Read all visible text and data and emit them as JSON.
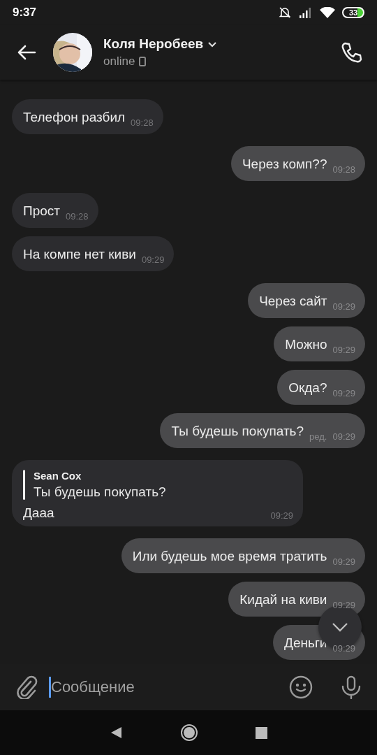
{
  "status_bar": {
    "time": "9:37",
    "battery": "33"
  },
  "header": {
    "name": "Коля Неробеев",
    "status": "online"
  },
  "messages": [
    {
      "kind": "incoming",
      "text": "Телефон разбил",
      "time": "09:28"
    },
    {
      "kind": "outgoing",
      "text": "Через комп??",
      "time": "09:28"
    },
    {
      "kind": "incoming",
      "text": "Прост",
      "time": "09:28"
    },
    {
      "kind": "incoming",
      "text": "На компе нет киви",
      "time": "09:29"
    },
    {
      "kind": "outgoing",
      "text": "Через сайт",
      "time": "09:29"
    },
    {
      "kind": "outgoing",
      "text": "Можно",
      "time": "09:29"
    },
    {
      "kind": "outgoing",
      "text": "Окда?",
      "time": "09:29"
    },
    {
      "kind": "outgoing",
      "text": "Ты будешь покупать?",
      "edited_label": "ред.",
      "time": "09:29"
    },
    {
      "kind": "incoming",
      "reply": {
        "author": "Sean Cox",
        "text": "Ты будешь покупать?"
      },
      "text": "Дааа",
      "time": "09:29"
    },
    {
      "kind": "outgoing",
      "text": "Или будешь мое время тратить",
      "time": "09:29"
    },
    {
      "kind": "outgoing",
      "text": "Кидай на киви",
      "time": "09:29"
    },
    {
      "kind": "outgoing",
      "text": "Деньги",
      "time": "09:29"
    }
  ],
  "composer": {
    "placeholder": "Сообщение"
  }
}
